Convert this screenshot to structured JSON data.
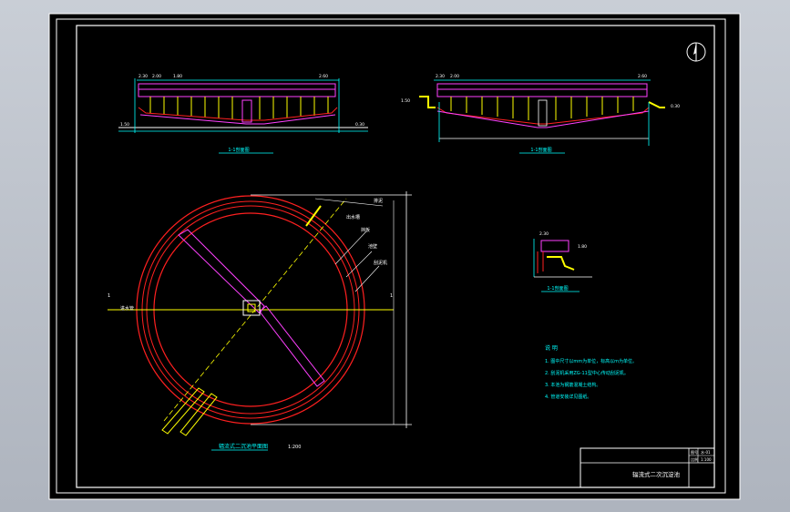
{
  "drawing": {
    "title": "辐流式二次沉淀池",
    "title_block": {
      "row1_label": "图号",
      "row1_value": "水-01",
      "row2_label": "比例",
      "row2_value": "1:100"
    }
  },
  "views": {
    "section_left_label": "1-1剖面图",
    "section_right_label": "1-1剖面图",
    "detail_label": "1-1剖面图",
    "plan_label": "辐流式二沉池平面图",
    "plan_scale": "1:200",
    "section_a": "1",
    "section_b": "1"
  },
  "callouts": {
    "c1": "出水槽",
    "c2": "挡板",
    "c3": "池壁",
    "c4": "刮泥机",
    "c5": "进水管",
    "c6": "排泥"
  },
  "levels": {
    "l1": "2.30",
    "l2": "2.00",
    "l3": "1.80",
    "l4": "2.60",
    "l5": "1.50",
    "l6": "0.30"
  },
  "notes": {
    "heading": "说 明",
    "items": [
      "1. 图中尺寸以mm为单位，标高以m为单位。",
      "2. 刮泥机采用ZG-11型中心传动刮泥机。",
      "3. 本池为钢筋混凝土结构。",
      "4. 管道安装详见图纸。"
    ]
  },
  "colors": {
    "paper": "#000000",
    "border": "#ffffff",
    "red": "#ff2020",
    "cyan": "#00ffff",
    "magenta": "#ff40ff",
    "yellow": "#ffff00",
    "green": "#40ff40"
  }
}
